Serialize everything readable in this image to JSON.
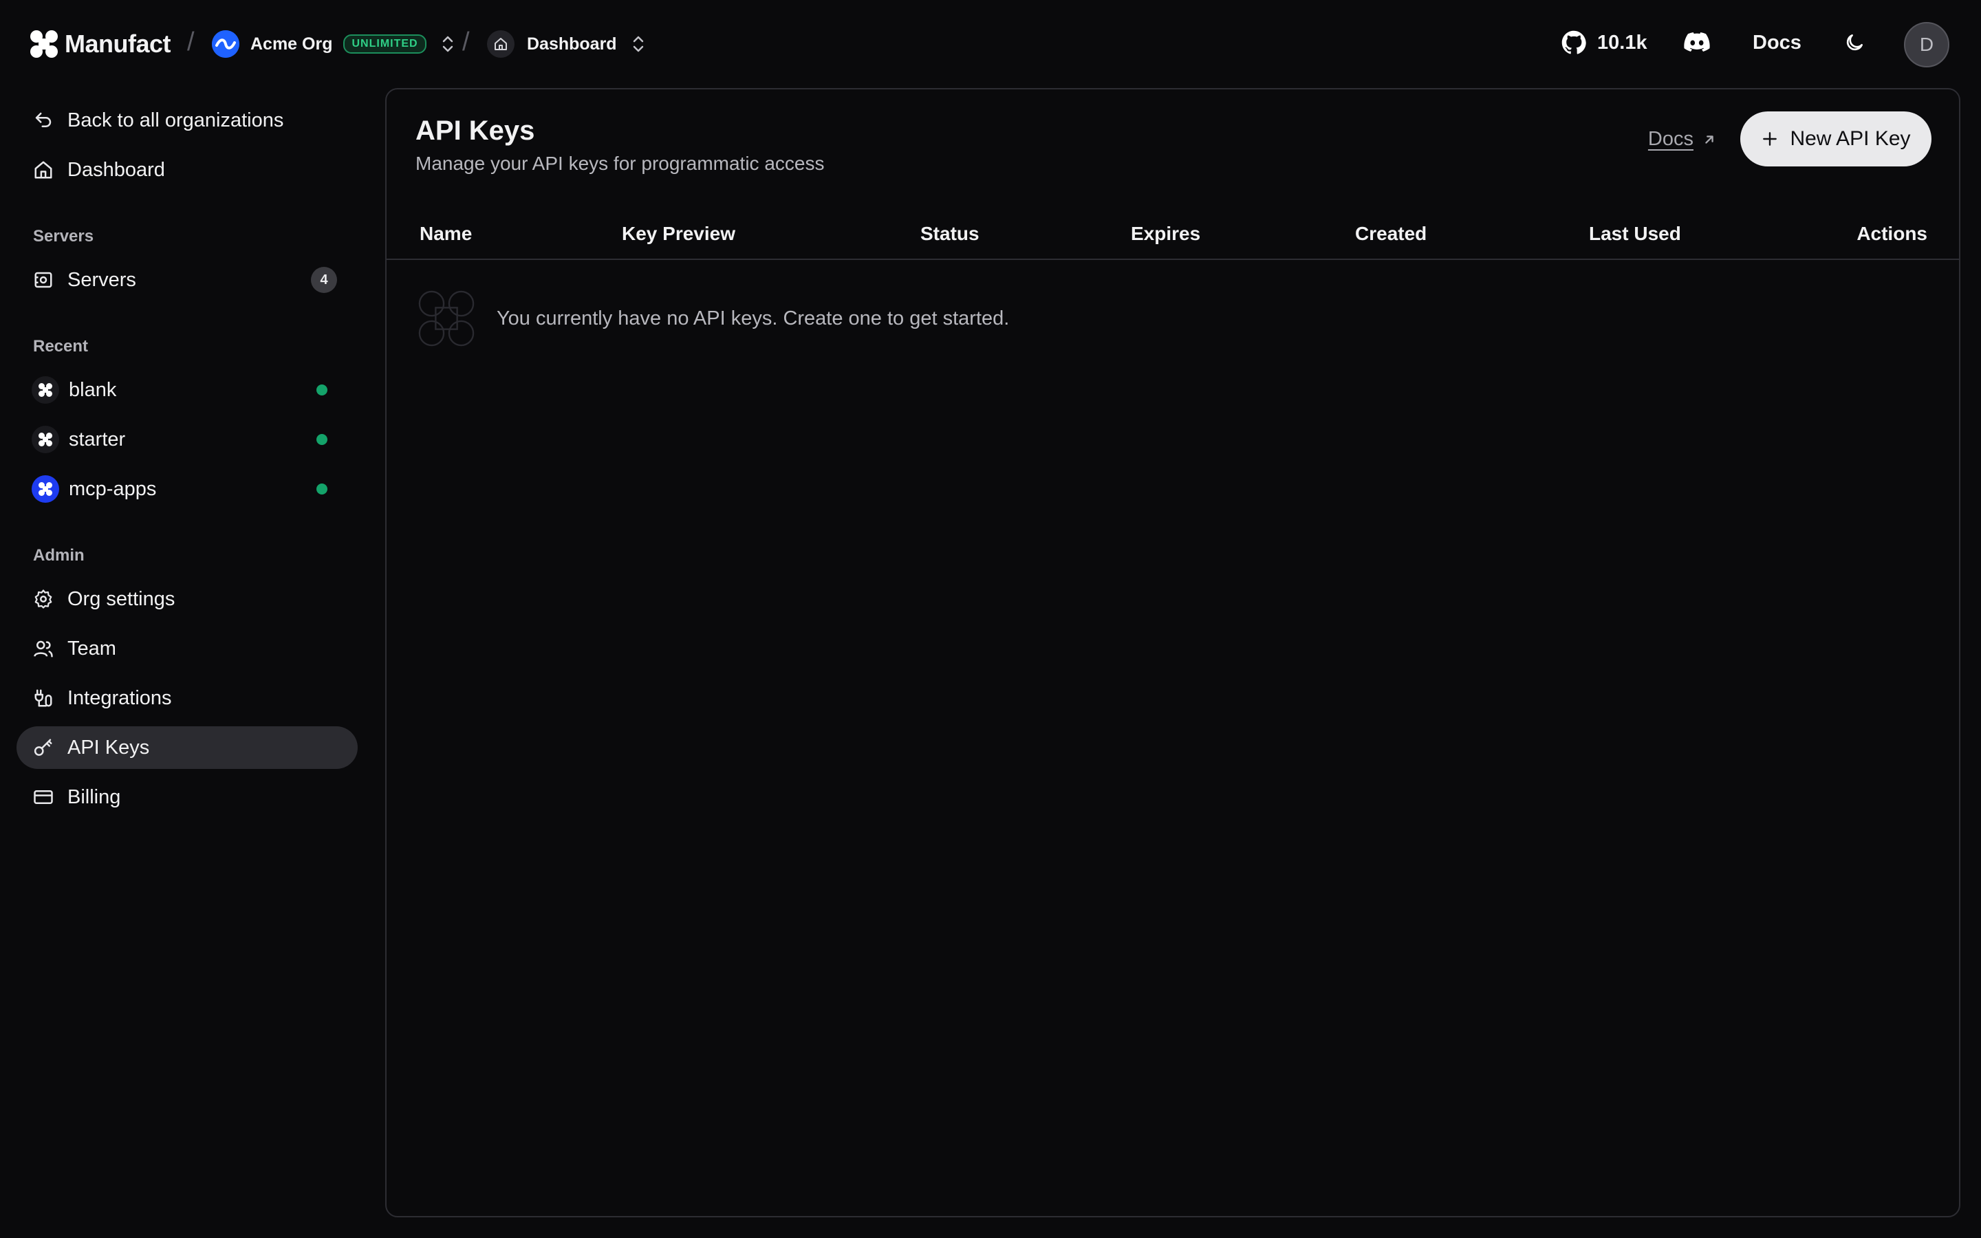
{
  "brand": {
    "name": "Manufact"
  },
  "breadcrumb": {
    "separator": "/",
    "org": {
      "name": "Acme Org",
      "badge": "UNLIMITED"
    },
    "page": {
      "name": "Dashboard"
    }
  },
  "topbar": {
    "github_stars": "10.1k",
    "docs_label": "Docs",
    "avatar_initial": "D"
  },
  "sidebar": {
    "back_label": "Back to all organizations",
    "dashboard_label": "Dashboard",
    "servers_section": "Servers",
    "servers_item": {
      "label": "Servers",
      "count": "4"
    },
    "recent_section": "Recent",
    "recent": [
      {
        "label": "blank",
        "status": "online"
      },
      {
        "label": "starter",
        "status": "online"
      },
      {
        "label": "mcp-apps",
        "status": "online"
      }
    ],
    "admin_section": "Admin",
    "admin": [
      {
        "label": "Org settings",
        "icon": "gear-icon"
      },
      {
        "label": "Team",
        "icon": "users-icon"
      },
      {
        "label": "Integrations",
        "icon": "integrations-icon"
      },
      {
        "label": "API Keys",
        "icon": "key-icon",
        "active": true
      },
      {
        "label": "Billing",
        "icon": "credit-card-icon"
      }
    ]
  },
  "main": {
    "title": "API Keys",
    "subtitle": "Manage your API keys for programmatic access",
    "docs_link": "Docs",
    "new_button": "New API Key",
    "columns": [
      "Name",
      "Key Preview",
      "Status",
      "Expires",
      "Created",
      "Last Used",
      "Actions"
    ],
    "empty_message": "You currently have no API keys. Create one to get started."
  },
  "colors": {
    "background": "#0a0a0c",
    "active_item": "#2b2b30",
    "status_online": "#14a36a",
    "badge_green": "#2fcf86",
    "button_bg": "#e9e9eb"
  }
}
